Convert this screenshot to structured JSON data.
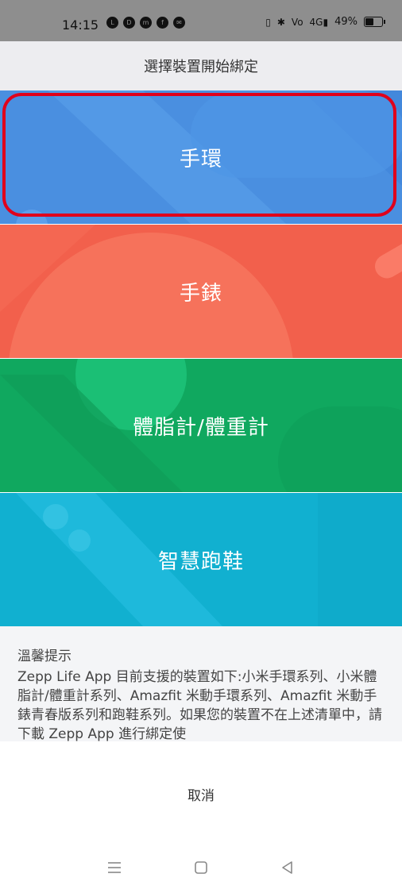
{
  "status_bar": {
    "time": "14:15",
    "app_icons": [
      "line-icon",
      "discord-icon",
      "messenger-icon",
      "facebook-icon",
      "mail-icon"
    ],
    "right_icons": [
      "vibrate-icon",
      "bluetooth-icon",
      "volte-icon",
      "4g-signal-icon"
    ],
    "battery_percent": "49%"
  },
  "header": {
    "title": "選擇裝置開始綁定"
  },
  "devices": [
    {
      "label": "手環",
      "color": "#4a8fe0",
      "selected": true
    },
    {
      "label": "手錶",
      "color": "#f2604c"
    },
    {
      "label": "體脂計/體重計",
      "color": "#10a85f"
    },
    {
      "label": "智慧跑鞋",
      "color": "#11b0d0"
    }
  ],
  "highlight_color": "#e0001b",
  "tips": {
    "title": "溫馨提示",
    "body": "Zepp Life App 目前支援的裝置如下:小米手環系列、小米體脂計/體重計系列、Amazfit 米動手環系列、Amazfit 米動手錶青春版系列和跑鞋系列。如果您的裝置不在上述清單中，請下載 Zepp App 進行綁定使"
  },
  "cancel_label": "取消",
  "nav": {
    "icons": [
      "menu-icon",
      "home-icon",
      "back-icon"
    ]
  }
}
